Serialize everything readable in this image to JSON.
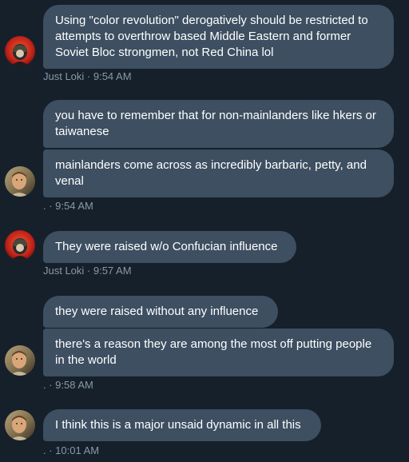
{
  "messages": [
    {
      "bubbles": [
        "Using \"color revolution\" derogatively should be restricted to attempts to overthrow based Middle Eastern and former Soviet Bloc strongmen, not Red China lol"
      ],
      "meta": "Just Loki · 9:54 AM",
      "avatar": "avatar-red-helmet"
    },
    {
      "bubbles": [
        "you have to remember that for non-mainlanders like hkers or taiwanese",
        "mainlanders come across as incredibly barbaric, petty, and venal"
      ],
      "meta": ". · 9:54 AM",
      "avatar": "avatar-man-portrait"
    },
    {
      "bubbles": [
        "They were raised w/o Confucian influence"
      ],
      "meta": "Just Loki · 9:57 AM",
      "avatar": "avatar-red-helmet"
    },
    {
      "bubbles": [
        "they were raised without any influence",
        "there's a reason they are among the most off putting people in the world"
      ],
      "meta": ". · 9:58 AM",
      "avatar": "avatar-man-portrait"
    },
    {
      "bubbles": [
        "I think this is a major unsaid dynamic in all this"
      ],
      "meta": ". · 10:01 AM",
      "avatar": "avatar-man-portrait"
    }
  ],
  "colors": {
    "background": "#15202b",
    "bubble": "#3d4f61",
    "text": "#ffffff",
    "meta": "#8899a6"
  }
}
